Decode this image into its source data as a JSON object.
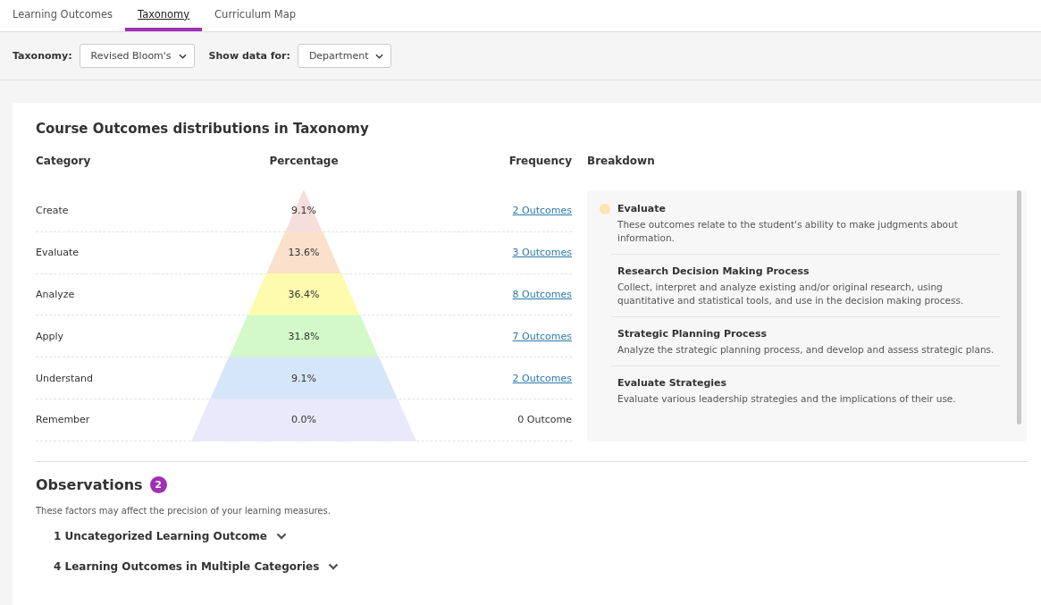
{
  "tabs": [
    {
      "label": "Learning Outcomes",
      "selected": false
    },
    {
      "label": "Taxonomy",
      "selected": true
    },
    {
      "label": "Curriculum Map",
      "selected": false
    }
  ],
  "filters": [
    {
      "label": "Taxonomy:",
      "value": "Revised Bloom's"
    },
    {
      "label": "Show data for:",
      "value": "Department"
    }
  ],
  "distribution": {
    "title": "Course Outcomes distributions in Taxonomy",
    "columns": [
      "Category",
      "Percentage",
      "Frequency"
    ],
    "rows": [
      {
        "category": "Create",
        "percentage": "9.1%",
        "frequency": "2 Outcomes",
        "link": true,
        "color": "#f6dedd"
      },
      {
        "category": "Evaluate",
        "percentage": "13.6%",
        "frequency": "3 Outcomes",
        "link": true,
        "color": "#fbe1cb"
      },
      {
        "category": "Analyze",
        "percentage": "36.4%",
        "frequency": "8 Outcomes",
        "link": true,
        "color": "#fdfcae"
      },
      {
        "category": "Apply",
        "percentage": "31.8%",
        "frequency": "7 Outcomes",
        "link": true,
        "color": "#d3f9c8"
      },
      {
        "category": "Understand",
        "percentage": "9.1%",
        "frequency": "2 Outcomes",
        "link": true,
        "color": "#d6e6fa"
      },
      {
        "category": "Remember",
        "percentage": "0.0%",
        "frequency": "0 Outcome",
        "link": false,
        "color": "#e9e9fb"
      }
    ]
  },
  "breakdown": {
    "title": "Breakdown",
    "category": {
      "name": "Evaluate",
      "color": "#fbe3b4",
      "description": "These outcomes relate to the student's ability to make judgments about information."
    },
    "outcomes": [
      {
        "name": "Research Decision Making Process",
        "description": "Collect, interpret and analyze existing and/or original research, using quantitative and statistical tools, and use in the decision making process."
      },
      {
        "name": "Strategic Planning Process",
        "description": "Analyze the strategic planning process, and develop and assess strategic plans."
      },
      {
        "name": "Evaluate Strategies",
        "description": "Evaluate various leadership strategies and the implications of their use."
      }
    ]
  },
  "observations": {
    "title": "Observations",
    "count": "2",
    "subtitle": "These factors may affect the precision of your learning measures.",
    "items": [
      {
        "label": "1 Uncategorized Learning Outcome",
        "expanded": false
      },
      {
        "label": "4 Learning Outcomes in Multiple Categories",
        "expanded": false
      }
    ]
  }
}
